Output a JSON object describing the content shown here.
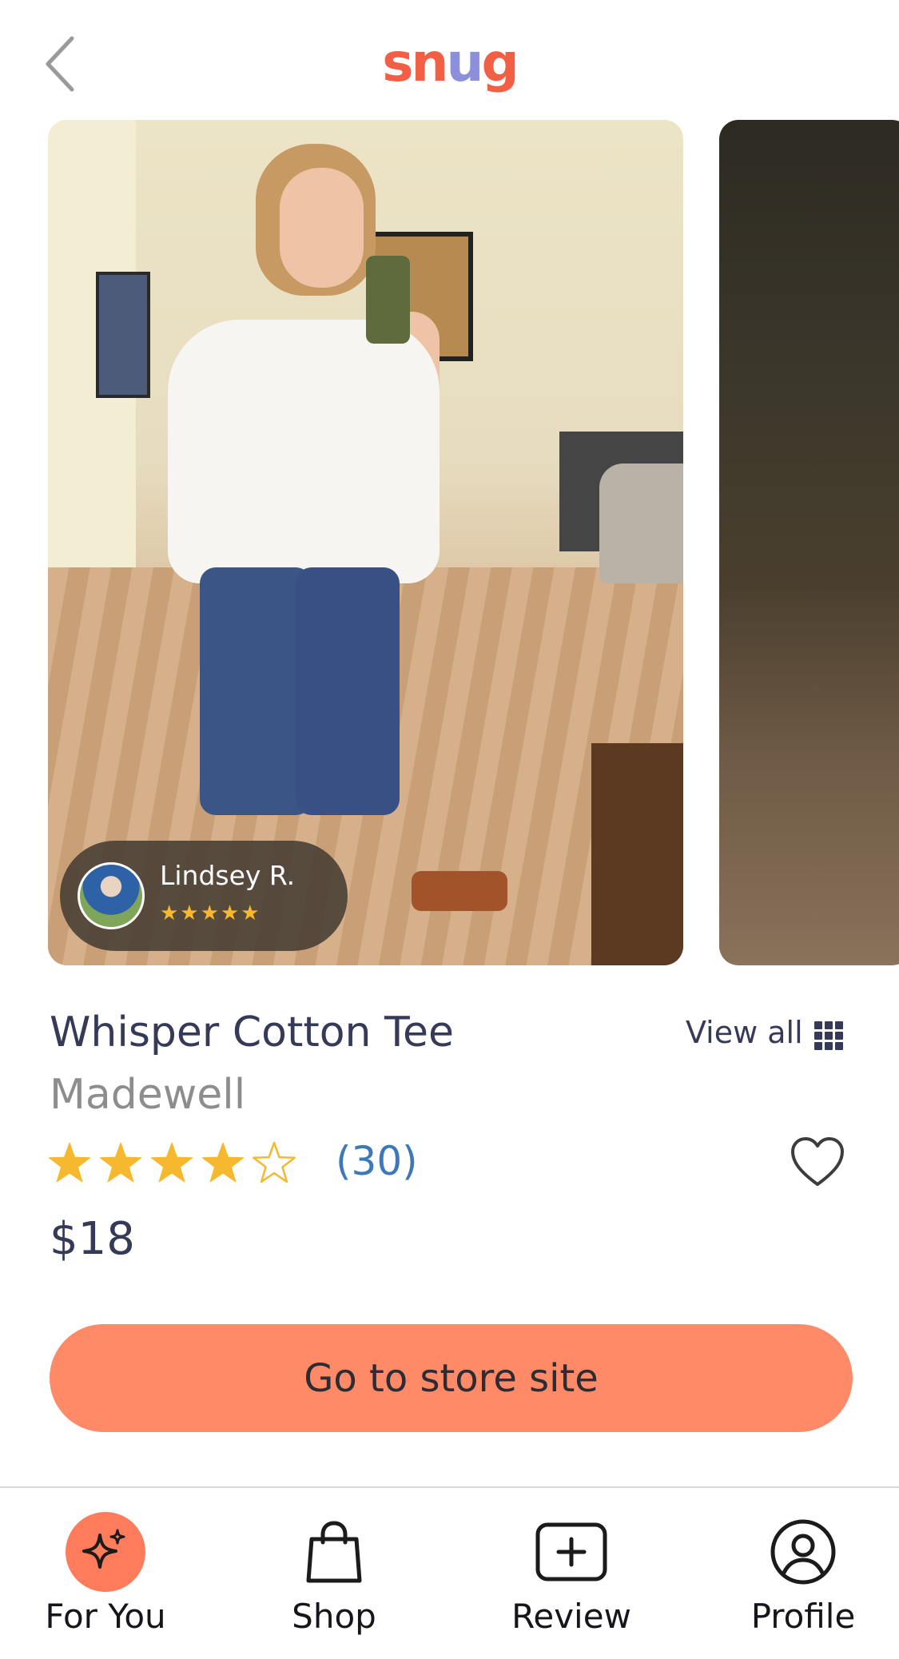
{
  "app": {
    "logo_text": "snug",
    "logo_colors": [
      "#f25f45",
      "#f25f45",
      "#8c8fdc",
      "#f25f45"
    ]
  },
  "header": {
    "back_icon": "chevron-left-icon"
  },
  "gallery": {
    "reviewer": {
      "name": "Lindsey R.",
      "stars": "★★★★★",
      "rating": 5
    }
  },
  "product": {
    "title": "Whisper Cotton Tee",
    "brand": "Madewell",
    "rating": 4,
    "rating_max": 5,
    "review_count": "(30)",
    "price": "$18",
    "view_all_label": "View all"
  },
  "cta": {
    "label": "Go to store site",
    "color": "#fe8a68"
  },
  "nav": {
    "items": [
      {
        "label": "For You",
        "icon": "sparkle-icon",
        "active": true
      },
      {
        "label": "Shop",
        "icon": "shopping-bag-icon",
        "active": false
      },
      {
        "label": "Review",
        "icon": "add-review-icon",
        "active": false
      },
      {
        "label": "Profile",
        "icon": "profile-icon",
        "active": false
      }
    ],
    "active_color": "#fe7b5c"
  },
  "colors": {
    "text_primary": "#353a58",
    "text_secondary": "#8d8d8d",
    "link": "#3d78b8",
    "star": "#f5b82e"
  }
}
